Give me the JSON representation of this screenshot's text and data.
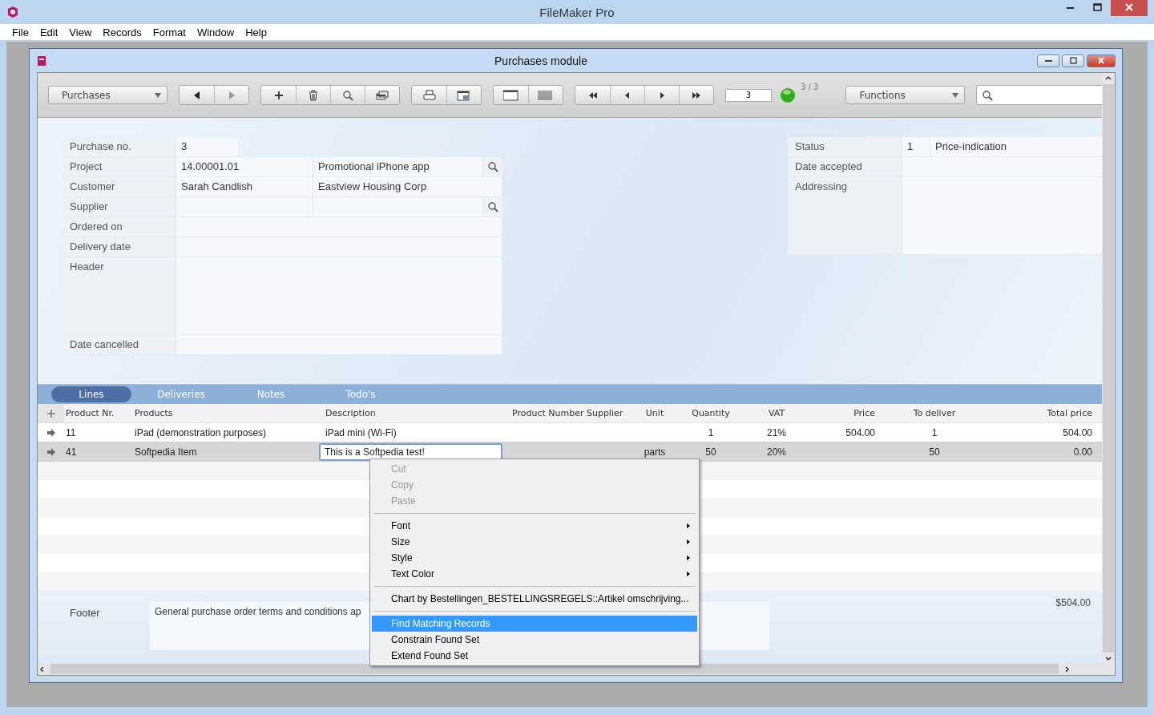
{
  "window": {
    "title": "FileMaker Pro"
  },
  "menu": [
    "File",
    "Edit",
    "View",
    "Records",
    "Format",
    "Window",
    "Help"
  ],
  "document": {
    "title": "Purchases module"
  },
  "toolbar": {
    "layout": "Purchases",
    "record_number": "3",
    "record_count": "3 / 3",
    "functions": "Functions"
  },
  "form": {
    "left": [
      {
        "label": "Purchase no.",
        "kind": "short",
        "values": [
          "3"
        ]
      },
      {
        "label": "Project",
        "kind": "lookup",
        "values": [
          "14.00001.01",
          "Promotional iPhone app"
        ]
      },
      {
        "label": "Customer",
        "kind": "pair",
        "values": [
          "Sarah Candlish",
          "Eastview Housing Corp"
        ]
      },
      {
        "label": "Supplier",
        "kind": "lookup"
      },
      {
        "label": "Ordered on",
        "kind": "single"
      },
      {
        "label": "Delivery date",
        "kind": "single"
      },
      {
        "label": "Header",
        "kind": "tall"
      },
      {
        "label": "Date cancelled",
        "kind": "single"
      }
    ],
    "right": [
      {
        "label": "Status",
        "kind": "pair",
        "values": [
          "1",
          "Price-indication"
        ]
      },
      {
        "label": "Date accepted",
        "kind": "single"
      },
      {
        "label": "Addressing",
        "kind": "tall"
      }
    ]
  },
  "tabs": [
    {
      "label": "Lines",
      "selected": true
    },
    {
      "label": "Deliveries",
      "selected": false
    },
    {
      "label": "Notes",
      "selected": false
    },
    {
      "label": "Todo's",
      "selected": false
    }
  ],
  "table": {
    "columns": [
      "Product Nr.",
      "Products",
      "Description",
      "Product Number Supplier",
      "Unit",
      "Quantity",
      "VAT",
      "Price",
      "To deliver",
      "Total price"
    ],
    "rows": [
      {
        "selected": false,
        "editing": false,
        "cells": [
          "11",
          "iPad (demonstration purposes)",
          "iPad mini (Wi-Fi)",
          "",
          "",
          "1",
          "21%",
          "504.00",
          "1",
          "504.00"
        ]
      },
      {
        "selected": true,
        "editing": true,
        "cells": [
          "41",
          "Softpedia Item",
          "This is a Softpedia test!",
          "",
          "parts",
          "50",
          "20%",
          "",
          "50",
          "0.00"
        ]
      }
    ]
  },
  "footer": {
    "label": "Footer",
    "text": "General purchase order terms and conditions ap",
    "total": "$504.00"
  },
  "context_menu": [
    {
      "kind": "item",
      "label": "Cut",
      "disabled": true,
      "submenu": false,
      "selected": false
    },
    {
      "kind": "item",
      "label": "Copy",
      "disabled": true,
      "submenu": false,
      "selected": false
    },
    {
      "kind": "item",
      "label": "Paste",
      "disabled": true,
      "submenu": false,
      "selected": false
    },
    {
      "kind": "separator"
    },
    {
      "kind": "item",
      "label": "Font",
      "disabled": false,
      "submenu": true,
      "selected": false
    },
    {
      "kind": "item",
      "label": "Size",
      "disabled": false,
      "submenu": true,
      "selected": false
    },
    {
      "kind": "item",
      "label": "Style",
      "disabled": false,
      "submenu": true,
      "selected": false
    },
    {
      "kind": "item",
      "label": "Text Color",
      "disabled": false,
      "submenu": true,
      "selected": false
    },
    {
      "kind": "separator"
    },
    {
      "kind": "item",
      "label": "Chart by Bestellingen_BESTELLINGSREGELS::Artikel omschrijving...",
      "disabled": false,
      "submenu": false,
      "selected": false
    },
    {
      "kind": "separator"
    },
    {
      "kind": "item",
      "label": "Find Matching Records",
      "disabled": false,
      "submenu": false,
      "selected": true
    },
    {
      "kind": "item",
      "label": "Constrain Found Set",
      "disabled": false,
      "submenu": false,
      "selected": false
    },
    {
      "kind": "item",
      "label": "Extend Found Set",
      "disabled": false,
      "submenu": false,
      "selected": false
    }
  ]
}
